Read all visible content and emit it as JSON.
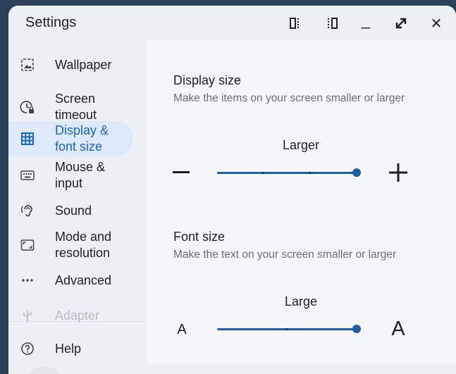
{
  "window": {
    "title": "Settings",
    "controls": [
      "split-left-icon",
      "split-right-icon",
      "minimize-icon",
      "maximize-icon",
      "close-icon"
    ],
    "minimize_glyph": "_",
    "maximize_glyph": "⤢",
    "close_glyph": "✕"
  },
  "sidebar": {
    "items": [
      {
        "label": "Wallpaper",
        "icon": "wallpaper-icon"
      },
      {
        "label": "Screen\ntimeout",
        "icon": "screen-timeout-icon"
      },
      {
        "label": "Display &\nfont size",
        "icon": "display-grid-icon",
        "active": true
      },
      {
        "label": "Mouse &\ninput",
        "icon": "keyboard-icon"
      },
      {
        "label": "Sound",
        "icon": "ear-icon"
      },
      {
        "label": "Mode and\nresolution",
        "icon": "aspect-ratio-icon"
      },
      {
        "label": "Advanced",
        "icon": "more-dots-icon"
      },
      {
        "label": "Adapter",
        "icon": "usb-icon",
        "disabled": true
      }
    ],
    "help": {
      "label": "Help",
      "icon": "help-icon"
    }
  },
  "display_size": {
    "title": "Display size",
    "description": "Make the items on your screen smaller or larger",
    "value_label": "Larger",
    "level": 1.0,
    "decrease_glyph": "—",
    "increase_glyph": "+"
  },
  "font_size": {
    "title": "Font size",
    "description": "Make the text on your screen smaller or larger",
    "value_label": "Large",
    "level": 1.0,
    "decrease_glyph": "A",
    "increase_glyph": "A"
  },
  "colors": {
    "accent": "#1a64c6",
    "active_bg": "#dceafb",
    "slider": "#1c5fa8"
  }
}
